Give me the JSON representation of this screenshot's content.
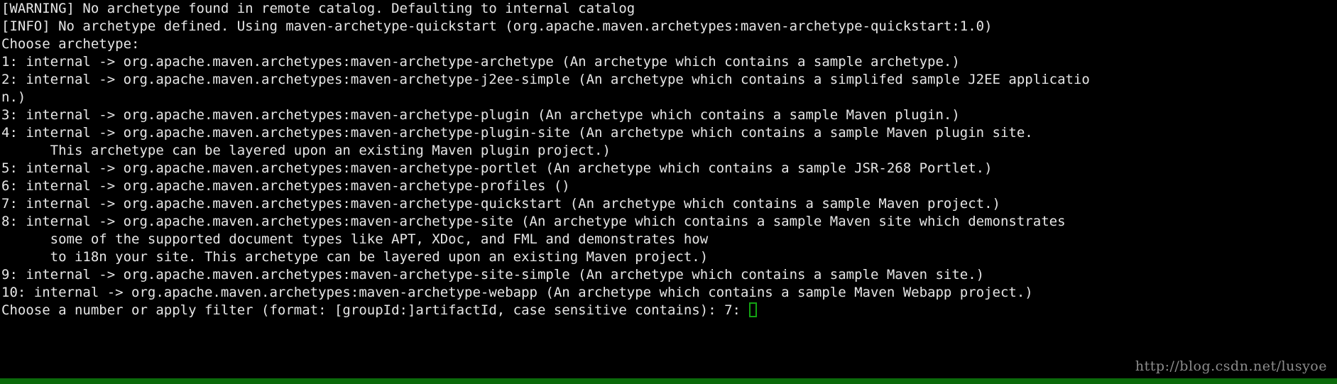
{
  "terminal": {
    "background_color": "#000000",
    "text_color": "#e6e6e6",
    "cursor_color": "#13a313",
    "bottom_bar_color": "#0b6b0b",
    "lines": [
      "[WARNING] No archetype found in remote catalog. Defaulting to internal catalog",
      "[INFO] No archetype defined. Using maven-archetype-quickstart (org.apache.maven.archetypes:maven-archetype-quickstart:1.0)",
      "Choose archetype:",
      "1: internal -> org.apache.maven.archetypes:maven-archetype-archetype (An archetype which contains a sample archetype.)",
      "2: internal -> org.apache.maven.archetypes:maven-archetype-j2ee-simple (An archetype which contains a simplifed sample J2EE applicatio",
      "n.)",
      "3: internal -> org.apache.maven.archetypes:maven-archetype-plugin (An archetype which contains a sample Maven plugin.)",
      "4: internal -> org.apache.maven.archetypes:maven-archetype-plugin-site (An archetype which contains a sample Maven plugin site.",
      "      This archetype can be layered upon an existing Maven plugin project.)",
      "5: internal -> org.apache.maven.archetypes:maven-archetype-portlet (An archetype which contains a sample JSR-268 Portlet.)",
      "6: internal -> org.apache.maven.archetypes:maven-archetype-profiles ()",
      "7: internal -> org.apache.maven.archetypes:maven-archetype-quickstart (An archetype which contains a sample Maven project.)",
      "8: internal -> org.apache.maven.archetypes:maven-archetype-site (An archetype which contains a sample Maven site which demonstrates",
      "      some of the supported document types like APT, XDoc, and FML and demonstrates how",
      "      to i18n your site. This archetype can be layered upon an existing Maven project.)",
      "9: internal -> org.apache.maven.archetypes:maven-archetype-site-simple (An archetype which contains a sample Maven site.)",
      "10: internal -> org.apache.maven.archetypes:maven-archetype-webapp (An archetype which contains a sample Maven Webapp project.)"
    ],
    "prompt": {
      "text": "Choose a number or apply filter (format: [groupId:]artifactId, case sensitive contains): 7: ",
      "input_value": ""
    }
  },
  "watermark": {
    "text": "http://blog.csdn.net/lusyoe"
  }
}
